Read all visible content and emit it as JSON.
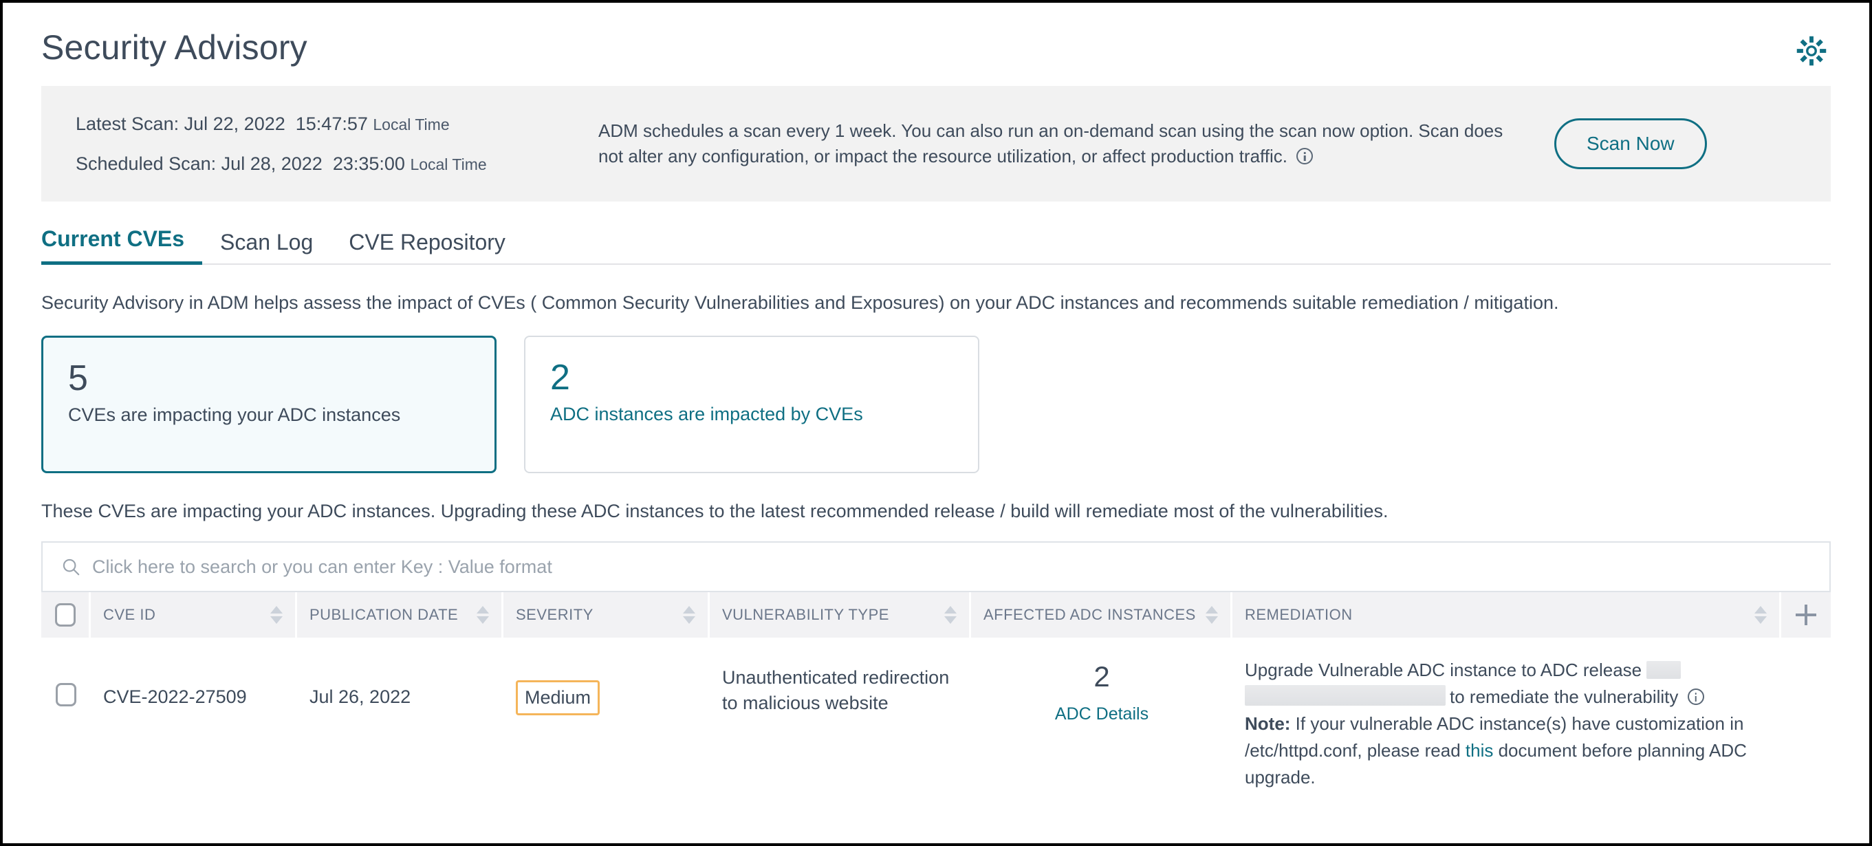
{
  "header": {
    "title": "Security Advisory",
    "gear_icon": "gear-icon"
  },
  "scan_banner": {
    "latest_scan_label": "Latest Scan:",
    "latest_scan_date": "Jul 22, 2022",
    "latest_scan_time": "15:47:57",
    "latest_scan_tz": "Local Time",
    "scheduled_scan_label": "Scheduled Scan:",
    "scheduled_scan_date": "Jul 28, 2022",
    "scheduled_scan_time": "23:35:00",
    "scheduled_scan_tz": "Local Time",
    "description": "ADM schedules a scan every 1 week. You can also run an on-demand scan using the scan now option. Scan does not alter any configuration, or impact the resource utilization, or affect production traffic.",
    "info_icon": "info-icon",
    "scan_now_label": "Scan Now"
  },
  "tabs": [
    {
      "label": "Current CVEs",
      "active": true
    },
    {
      "label": "Scan Log",
      "active": false
    },
    {
      "label": "CVE Repository",
      "active": false
    }
  ],
  "intro_text": "Security Advisory in ADM helps assess the impact of CVEs ( Common Security Vulnerabilities and Exposures) on your ADC instances and recommends suitable remediation / mitigation.",
  "cards": [
    {
      "value": "5",
      "label": "CVEs are impacting your ADC instances",
      "selected": true
    },
    {
      "value": "2",
      "label": "ADC instances are impacted by CVEs",
      "selected": false
    }
  ],
  "sub_text": "These CVEs are impacting your ADC instances. Upgrading these ADC instances to the latest recommended release / build will remediate most of the vulnerabilities.",
  "search": {
    "placeholder": "Click here to search or you can enter Key : Value format",
    "value": "",
    "icon": "search-icon"
  },
  "table": {
    "columns": [
      {
        "label": "CVE ID",
        "sortable": true
      },
      {
        "label": "PUBLICATION DATE",
        "sortable": true
      },
      {
        "label": "SEVERITY",
        "sortable": true
      },
      {
        "label": "VULNERABILITY TYPE",
        "sortable": true
      },
      {
        "label": "AFFECTED ADC INSTANCES",
        "sortable": true
      },
      {
        "label": "REMEDIATION",
        "sortable": true
      }
    ],
    "add_column_icon": "plus-icon",
    "rows": [
      {
        "cve_id": "CVE-2022-27509",
        "publication_date": "Jul 26, 2022",
        "severity": "Medium",
        "severity_color": "#f5b55a",
        "vulnerability_type": "Unauthenticated redirection to malicious website",
        "affected_count": "2",
        "affected_link": "ADC Details",
        "remediation_prefix": "Upgrade Vulnerable ADC instance to ADC release",
        "remediation_suffix": "to remediate the vulnerability",
        "remediation_info_icon": "info-icon",
        "note_label": "Note:",
        "note_text_1": "If your vulnerable ADC instance(s) have customization in /etc/httpd.conf, please read",
        "note_link": "this",
        "note_text_2": "document before planning ADC upgrade."
      }
    ]
  },
  "colors": {
    "accent": "#0f6f83",
    "text": "#3e4b5b",
    "banner_bg": "#f2f2f2",
    "header_bg": "#f2f2f4",
    "warning": "#f5b55a"
  }
}
